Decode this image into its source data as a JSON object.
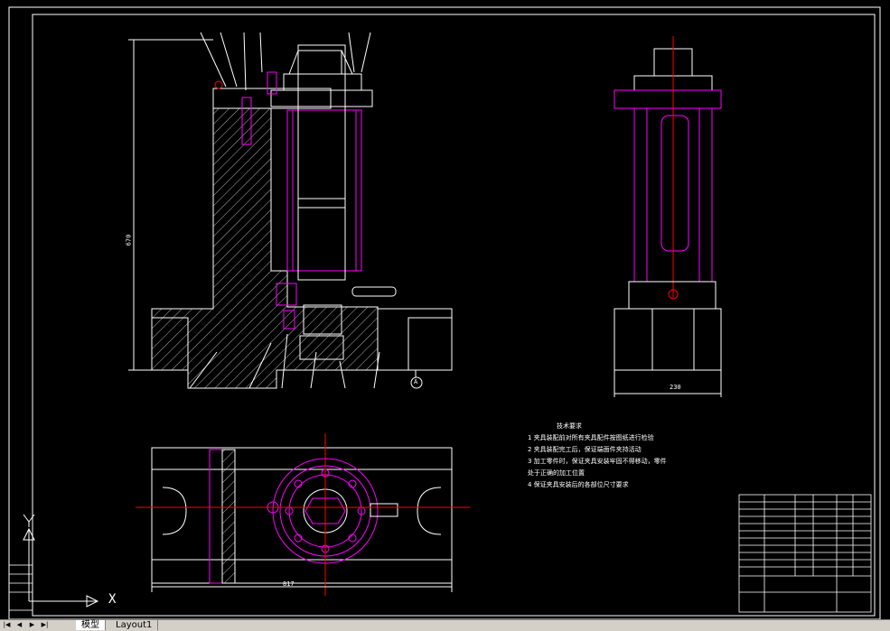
{
  "drawing": {
    "tech_requirements": {
      "title": "技术要求",
      "items": [
        "1  夹具装配前对所有夹具配件按图纸进行检验",
        "2  夹具装配完工后，保证端面件夹持活动",
        "3  加工零件时，保证夹具安装牢固不得移动，零件",
        "    处于正确的加工位置",
        "4  保证夹具安装后的各部位尺寸要求"
      ]
    },
    "dimensions": {
      "overall_height": "670",
      "side_width": "230",
      "plan_length": "817",
      "datum_label": "A"
    },
    "ucs_label": "X"
  },
  "layout_tabs": {
    "model": "模型",
    "layout1": "Layout1"
  },
  "colors": {
    "background": "#000000",
    "line": "#ffffff",
    "magenta": "#ff00ff",
    "red": "#ff0000"
  }
}
